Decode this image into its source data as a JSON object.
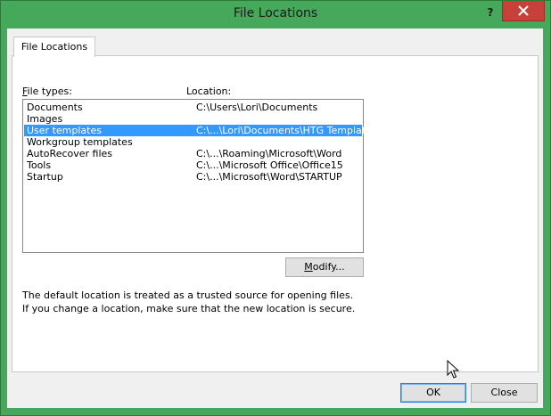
{
  "window": {
    "title": "File Locations",
    "help_glyph": "?",
    "close_icon": "close-icon"
  },
  "tab": {
    "label": "File Locations"
  },
  "labels": {
    "file_types_prefix": "F",
    "file_types_rest": "ile types:",
    "location": "Location:"
  },
  "file_locations": [
    {
      "type": "Documents",
      "location": "C:\\Users\\Lori\\Documents",
      "selected": false
    },
    {
      "type": "Images",
      "location": "",
      "selected": false
    },
    {
      "type": "User templates",
      "location": "C:\\...\\Lori\\Documents\\HTG Templates",
      "selected": true
    },
    {
      "type": "Workgroup templates",
      "location": "",
      "selected": false
    },
    {
      "type": "AutoRecover files",
      "location": "C:\\...\\Roaming\\Microsoft\\Word",
      "selected": false
    },
    {
      "type": "Tools",
      "location": "C:\\...\\Microsoft Office\\Office15",
      "selected": false
    },
    {
      "type": "Startup",
      "location": "C:\\...\\Microsoft\\Word\\STARTUP",
      "selected": false
    }
  ],
  "buttons": {
    "modify_prefix": "M",
    "modify_rest": "odify...",
    "ok": "OK",
    "close": "Close"
  },
  "note": "The default location is treated as a trusted source for opening files. If you change a location, make sure that the new location is secure.",
  "colors": {
    "titlebar": "#45a85a",
    "close_button": "#c7413a",
    "selection": "#3399ff"
  }
}
